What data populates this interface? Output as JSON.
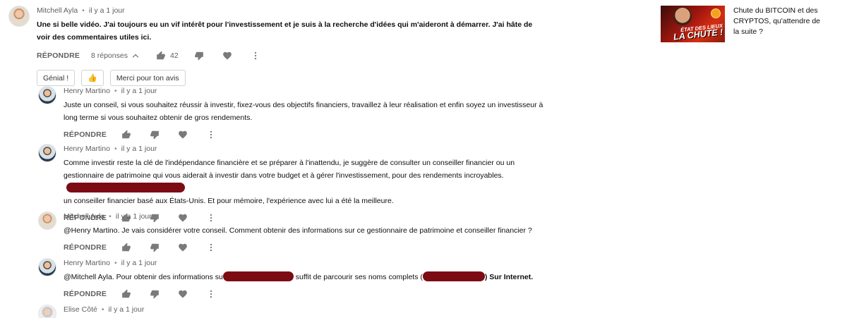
{
  "top_comment": {
    "author": "Mitchell Ayla",
    "time": "il y a 1 jour",
    "text": "Une si belle vidéo.  J'ai toujours eu un vif intérêt pour l'investissement et je suis à la recherche d'idées qui m'aideront à démarrer.  J'ai hâte de voir des commentaires utiles ici.",
    "reply_label": "RÉPONDRE",
    "replies_label": "8 réponses",
    "likes": "42",
    "chips": [
      "Génial !",
      "👍",
      "Merci pour ton avis"
    ]
  },
  "replies": [
    {
      "author": "Henry Martino",
      "time": "il y a 1 jour",
      "text": "Juste un conseil, si vous souhaitez réussir à investir, fixez-vous des objectifs financiers, travaillez à leur réalisation et enfin soyez un investisseur à long terme si vous souhaitez obtenir de gros rendements.",
      "reply_label": "RÉPONDRE"
    },
    {
      "author": "Henry Martino",
      "time": "il y a 1 jour",
      "text_a": "Comme investir reste la clé de l'indépendance financière et se préparer à l'inattendu, je suggère de consulter un conseiller financier ou un gestionnaire de patrimoine qui vous aiderait à investir dans votre budget et à gérer l'investissement, pour des rendements incroyables.",
      "text_b": "un conseiller financier basé aux États-Unis.  Et pour mémoire, l'expérience avec lui a été la meilleure.",
      "reply_label": "RÉPONDRE"
    },
    {
      "author": "Mitchell Ayla",
      "time": "il y a 1 jour",
      "text": "@Henry Martino. Je vais considérer votre conseil.  Comment obtenir des informations sur ce gestionnaire de patrimoine et conseiller financier ?",
      "reply_label": "RÉPONDRE"
    },
    {
      "author": "Henry Martino",
      "time": "il y a 1 jour",
      "text_a": "@Mitchell Ayla. Pour obtenir des informations su",
      "text_b": " suffit de parcourir ses noms complets (",
      "text_c": ") Sur Internet.",
      "reply_label": "RÉPONDRE"
    },
    {
      "author": "Elise Côté",
      "time": "il y a 1 jour"
    }
  ],
  "sidebar": {
    "video_title": "Chute du BITCOIN et des CRYPTOS, qu'attendre de la suite ?",
    "thumb_line1": "ÉTAT DES LIEUX",
    "thumb_line2": "LA CHUTE !"
  },
  "colors": {
    "redaction": "#7d0b14",
    "meta": "#606060"
  },
  "icons": [
    "thumb-up-icon",
    "thumb-down-icon",
    "heart-icon",
    "more-vert-icon",
    "chevron-up-icon"
  ]
}
